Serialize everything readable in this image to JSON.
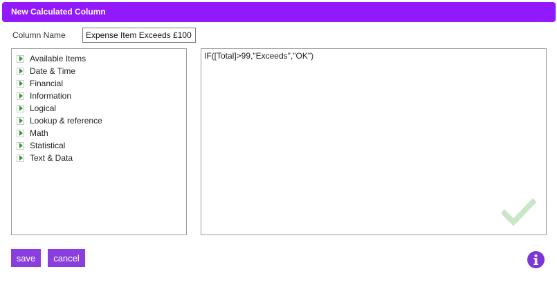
{
  "dialog": {
    "title": "New Calculated Column"
  },
  "column_name": {
    "label": "Column Name",
    "value": "Expense Item Exceeds £100"
  },
  "categories": [
    {
      "label": "Available Items"
    },
    {
      "label": "Date & Time"
    },
    {
      "label": "Financial"
    },
    {
      "label": "Information"
    },
    {
      "label": "Logical"
    },
    {
      "label": "Lookup & reference"
    },
    {
      "label": "Math"
    },
    {
      "label": "Statistical"
    },
    {
      "label": "Text & Data"
    }
  ],
  "formula": {
    "value": "IF([Total]>99,\"Exceeds\",\"OK\")"
  },
  "buttons": {
    "save_label": "save",
    "cancel_label": "cancel"
  },
  "icons": {
    "expand": "chevron-right-icon",
    "valid": "checkmark-icon",
    "info": "info-icon"
  },
  "colors": {
    "accent": "#9119fb",
    "button": "#8a3ee0",
    "valid_check": "#c9e7c7",
    "expand_arrow": "#2a9b2a"
  }
}
